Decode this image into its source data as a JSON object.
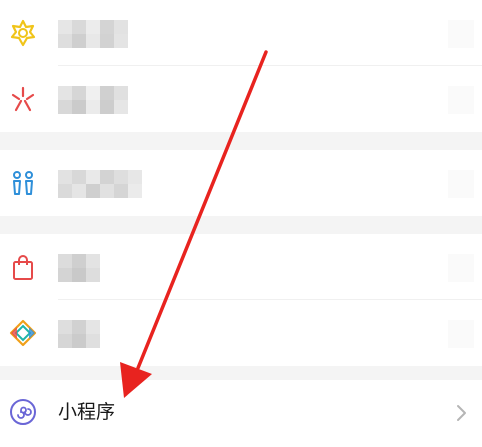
{
  "menu": {
    "items": [
      {
        "icon": "star-badge-icon"
      },
      {
        "icon": "sparkle-icon"
      },
      {
        "icon": "people-icon"
      },
      {
        "icon": "shopping-bag-icon"
      },
      {
        "icon": "diamond-icon"
      },
      {
        "icon": "mini-program-icon",
        "label": "小程序"
      }
    ]
  },
  "annotation": {
    "arrow_color": "#e8231f"
  },
  "colors": {
    "accent_yellow": "#f0c419",
    "accent_red": "#e64a4a",
    "accent_blue": "#2e8fd9",
    "mini_program_purple": "#6a66d6"
  }
}
